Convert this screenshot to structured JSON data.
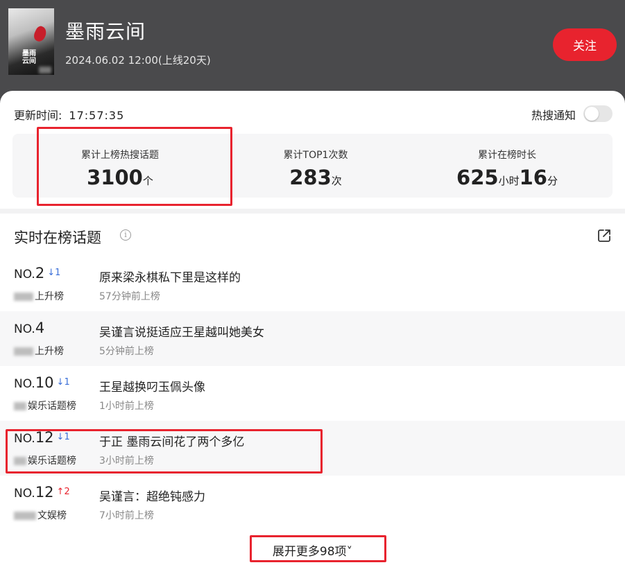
{
  "header": {
    "poster_title": "墨雨云间",
    "title": "墨雨云间",
    "date": "2024.06.02 12:00(上线20天)",
    "follow_label": "关注",
    "colors": {
      "follow_bg": "#e8232e",
      "header_bg": "#4a4a4c"
    }
  },
  "update": {
    "label": "更新时间:",
    "time": "17:57:35"
  },
  "notify": {
    "label": "热搜通知",
    "enabled": false
  },
  "stats": [
    {
      "label": "累计上榜热搜话题",
      "value": "3100",
      "unit": "个"
    },
    {
      "label": "累计TOP1次数",
      "value": "283",
      "unit": "次"
    },
    {
      "label": "累计在榜时长",
      "hours": "625",
      "hours_unit": "小时",
      "minutes": "16",
      "minutes_unit": "分"
    }
  ],
  "section": {
    "title": "实时在榜话题",
    "info_icon": "info-icon",
    "share_icon": "share-icon"
  },
  "topics": [
    {
      "no_prefix": "NO.",
      "rank": "2",
      "change": "↓1",
      "direction": "down",
      "board": "上升榜",
      "title": "原来梁永棋私下里是这样的",
      "ago": "57分钟前上榜"
    },
    {
      "no_prefix": "NO.",
      "rank": "4",
      "change": "",
      "direction": "none",
      "board": "上升榜",
      "title": "吴谨言说挺适应王星越叫她美女",
      "ago": "5分钟前上榜"
    },
    {
      "no_prefix": "NO.",
      "rank": "10",
      "change": "↓1",
      "direction": "down",
      "board": "娱乐话题榜",
      "title": "王星越换叼玉佩头像",
      "ago": "1小时前上榜"
    },
    {
      "no_prefix": "NO.",
      "rank": "12",
      "change": "↓1",
      "direction": "down",
      "board": "娱乐话题榜",
      "title": "于正 墨雨云间花了两个多亿",
      "ago": "3小时前上榜"
    },
    {
      "no_prefix": "NO.",
      "rank": "12",
      "change": "↑2",
      "direction": "up",
      "board": "文娱榜",
      "title": "吴谨言：超绝钝感力",
      "ago": "7小时前上榜"
    }
  ],
  "expand_label": "展开更多98项˅"
}
